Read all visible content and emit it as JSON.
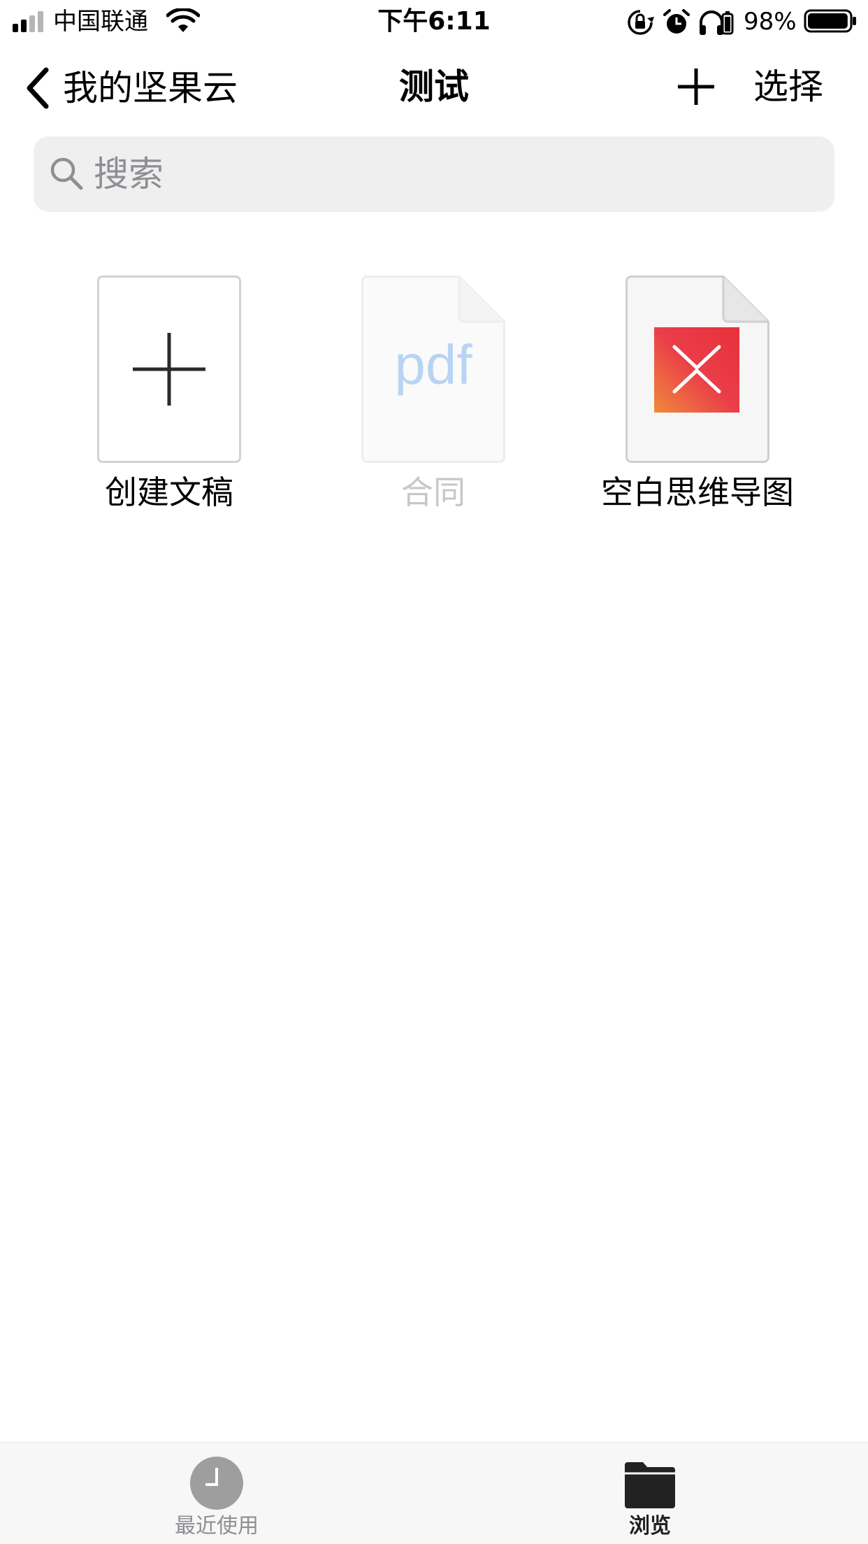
{
  "status_bar": {
    "carrier": "中国联通",
    "time": "下午6:11",
    "battery_percent": "98%",
    "battery_level": 0.98,
    "icons": [
      "signal-icon",
      "wifi-icon",
      "orientation-lock-icon",
      "alarm-icon",
      "headphones-icon",
      "battery-icon"
    ]
  },
  "nav": {
    "back_label": "我的坚果云",
    "title": "测试",
    "add_icon": "plus-icon",
    "select_label": "选择"
  },
  "search": {
    "placeholder": "搜索",
    "value": ""
  },
  "items": [
    {
      "label": "创建文稿",
      "icon": "plus-icon",
      "enabled": true
    },
    {
      "label": "合同",
      "icon": "pdf-file-icon",
      "thumb_text": "pdf",
      "enabled": false
    },
    {
      "label": "空白思维导图",
      "icon": "xmind-file-icon",
      "enabled": true
    }
  ],
  "tab_bar": {
    "tabs": [
      {
        "label": "最近使用",
        "icon": "clock-icon",
        "selected": false
      },
      {
        "label": "浏览",
        "icon": "folder-icon",
        "selected": true
      }
    ]
  },
  "colors": {
    "tab_selected": "#222222",
    "tab_unselected": "#8e8e93",
    "search_bg": "#efeff0",
    "pdf_text": "#4a90e2",
    "xmind_orange": "#f08a3b",
    "xmind_red": "#e8303a"
  }
}
